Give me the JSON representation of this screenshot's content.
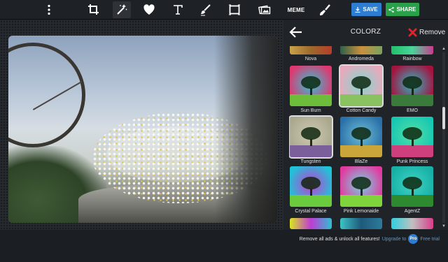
{
  "toolbar": {
    "tools": [
      {
        "name": "more-menu",
        "icon": "kebab-icon"
      },
      {
        "name": "crop",
        "icon": "crop-icon"
      },
      {
        "name": "effects",
        "icon": "magic-wand-icon"
      },
      {
        "name": "stickers",
        "icon": "heart-icon"
      },
      {
        "name": "text",
        "icon": "text-icon"
      },
      {
        "name": "draw",
        "icon": "brush-icon"
      },
      {
        "name": "frames",
        "icon": "frame-icon"
      },
      {
        "name": "overlays",
        "icon": "photos-icon"
      },
      {
        "name": "meme",
        "icon": "meme-icon"
      },
      {
        "name": "touchup",
        "icon": "paint-brush-icon"
      }
    ],
    "meme_label": "MEME",
    "save_label": "SAVE",
    "share_label": "SHARE",
    "colors": {
      "save": "#2d7dd2",
      "share": "#2aa04a"
    }
  },
  "panel": {
    "title": "COLORZ",
    "remove_label": "Remove",
    "filters": [
      {
        "label": "Nova",
        "partial": true,
        "colors": [
          "#c9a24a",
          "#9d6a2c",
          "#b83c2a"
        ]
      },
      {
        "label": "Andromeda",
        "partial": true,
        "colors": [
          "#2e5f4a",
          "#c9903d",
          "#7aa25f"
        ]
      },
      {
        "label": "Rainbow",
        "partial": true,
        "colors": [
          "#21c06a",
          "#4ad49b",
          "#c83c8e"
        ]
      },
      {
        "label": "Sun Burn",
        "colors": [
          "#e0376e",
          "#2bc6d8",
          "#6ebd3a"
        ]
      },
      {
        "label": "Cotton Candy",
        "colors": [
          "#e9a9bc",
          "#7fd8d0",
          "#8ac262"
        ],
        "selected": true
      },
      {
        "label": "EMO",
        "colors": [
          "#a5123e",
          "#2bb7c1",
          "#3a7a3a"
        ]
      },
      {
        "label": "Tungsten",
        "colors": [
          "#a9a88d",
          "#cfcab3",
          "#7a5f9a"
        ],
        "selected": true
      },
      {
        "label": "BlaZe",
        "colors": [
          "#2b6fa8",
          "#6bbfd6",
          "#c9a53a"
        ]
      },
      {
        "label": "Punk Princess",
        "colors": [
          "#16c7b2",
          "#53e0a6",
          "#cf3f7e"
        ]
      },
      {
        "label": "Crystal Palace",
        "colors": [
          "#1fc3d8",
          "#c63bd0",
          "#6acb3c"
        ]
      },
      {
        "label": "Pink Lemonaide",
        "colors": [
          "#e3399e",
          "#6fd8e6",
          "#7fd43c"
        ]
      },
      {
        "label": "AgentZ",
        "colors": [
          "#16b0a6",
          "#41d3c4",
          "#2e8a2e"
        ]
      },
      {
        "label": "",
        "partial": true,
        "colors": [
          "#d8e61f",
          "#c03bd4",
          "#2ec0d0"
        ]
      },
      {
        "label": "",
        "partial": true,
        "colors": [
          "#3cc3c6",
          "#1f5a7a",
          "#2e7a9a"
        ]
      },
      {
        "label": "",
        "partial": true,
        "colors": [
          "#2fd0e0",
          "#c0c0c0",
          "#d83e8a"
        ]
      }
    ]
  },
  "promo": {
    "text": "Remove all ads & unlock all features!",
    "link": "Upgrade to",
    "badge": "Pro",
    "trial": "Free trial"
  }
}
